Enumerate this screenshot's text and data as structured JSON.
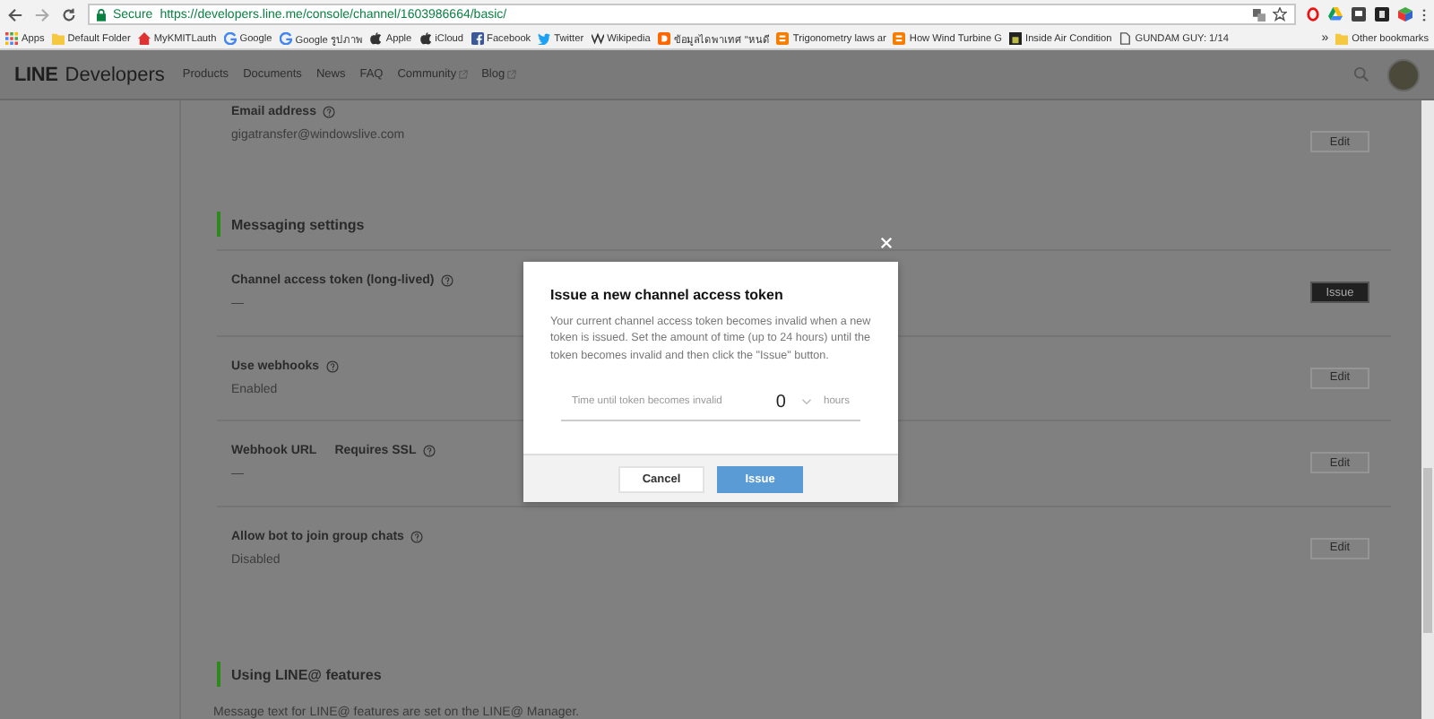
{
  "browser": {
    "secure_label": "Secure",
    "url": "https://developers.line.me/console/channel/1603986664/basic/",
    "bookmarks": [
      {
        "label": "Apps"
      },
      {
        "label": "Default Folder"
      },
      {
        "label": "MyKMITLauth"
      },
      {
        "label": "Google"
      },
      {
        "label": "Google รูปภาพ"
      },
      {
        "label": "Apple"
      },
      {
        "label": "iCloud"
      },
      {
        "label": "Facebook"
      },
      {
        "label": "Twitter"
      },
      {
        "label": "Wikipedia"
      },
      {
        "label": "ข้อมูลไดพาเทศ \"หนดี"
      },
      {
        "label": "Trigonometry laws ar"
      },
      {
        "label": "How Wind Turbine G"
      },
      {
        "label": "Inside Air Condition"
      },
      {
        "label": "GUNDAM GUY: 1/14"
      }
    ],
    "more": "»",
    "other_bookmarks": "Other bookmarks"
  },
  "header": {
    "logo_brand": "LINE",
    "logo_product": "Developers",
    "nav": [
      {
        "label": "Products",
        "external": false
      },
      {
        "label": "Documents",
        "external": false
      },
      {
        "label": "News",
        "external": false
      },
      {
        "label": "FAQ",
        "external": false
      },
      {
        "label": "Community",
        "external": true
      },
      {
        "label": "Blog",
        "external": true
      }
    ]
  },
  "settings": [
    {
      "kind": "field",
      "label": "Email address",
      "help": true,
      "value": "gigatransfer@windowslive.com",
      "button": {
        "label": "Edit",
        "kind": "default"
      }
    },
    {
      "kind": "heading",
      "label": "Messaging settings"
    },
    {
      "kind": "field",
      "label": "Channel access token (long-lived)",
      "help": true,
      "value": "—",
      "button": {
        "label": "Issue",
        "kind": "dark"
      }
    },
    {
      "kind": "field",
      "label": "Use webhooks",
      "help": true,
      "value": "Enabled",
      "button": {
        "label": "Edit",
        "kind": "default"
      }
    },
    {
      "kind": "field",
      "label": "Webhook URL",
      "note": "Requires SSL",
      "help": true,
      "value": "—",
      "button": {
        "label": "Edit",
        "kind": "default"
      }
    },
    {
      "kind": "field",
      "label": "Allow bot to join group chats",
      "help": true,
      "value": "Disabled",
      "button": {
        "label": "Edit",
        "kind": "default"
      }
    },
    {
      "kind": "heading",
      "label": "Using LINE@ features"
    },
    {
      "kind": "text",
      "label": "Message text for LINE@ features are set on the LINE@ Manager."
    }
  ],
  "modal": {
    "title": "Issue a new channel access token",
    "body": "Your current channel access token becomes invalid when a new token is issued. Set the amount of time (up to 24 hours) until the token becomes invalid and then click the \"Issue\" button.",
    "field_label": "Time until token becomes invalid",
    "field_value": "0",
    "field_unit": "hours",
    "buttons": [
      {
        "label": "Cancel",
        "kind": "secondary"
      },
      {
        "label": "Issue",
        "kind": "primary"
      }
    ]
  }
}
